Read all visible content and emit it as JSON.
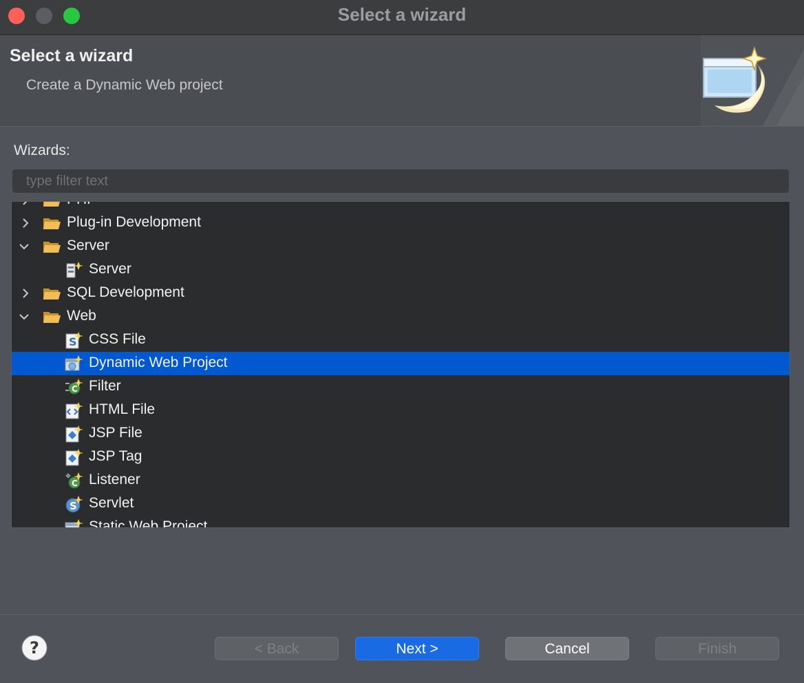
{
  "window": {
    "title": "Select a wizard"
  },
  "header": {
    "title": "Select a wizard",
    "subtitle": "Create a Dynamic Web project"
  },
  "wizards": {
    "label": "Wizards:",
    "filter_placeholder": "type filter text",
    "items": [
      {
        "label": "PHP",
        "indent": 0,
        "type": "folder",
        "state": "collapsed",
        "icon": "folder-icon"
      },
      {
        "label": "Plug-in Development",
        "indent": 0,
        "type": "folder",
        "state": "collapsed",
        "icon": "folder-icon"
      },
      {
        "label": "Server",
        "indent": 0,
        "type": "folder",
        "state": "expanded",
        "icon": "folder-icon"
      },
      {
        "label": "Server",
        "indent": 1,
        "type": "item",
        "icon": "server-wizard-icon"
      },
      {
        "label": "SQL Development",
        "indent": 0,
        "type": "folder",
        "state": "collapsed",
        "icon": "folder-icon"
      },
      {
        "label": "Web",
        "indent": 0,
        "type": "folder",
        "state": "expanded",
        "icon": "folder-icon"
      },
      {
        "label": "CSS File",
        "indent": 1,
        "type": "item",
        "icon": "css-file-icon"
      },
      {
        "label": "Dynamic Web Project",
        "indent": 1,
        "type": "item",
        "icon": "dynamic-web-project-icon",
        "selected": true
      },
      {
        "label": "Filter",
        "indent": 1,
        "type": "item",
        "icon": "filter-class-icon"
      },
      {
        "label": "HTML File",
        "indent": 1,
        "type": "item",
        "icon": "html-file-icon"
      },
      {
        "label": "JSP File",
        "indent": 1,
        "type": "item",
        "icon": "jsp-file-icon"
      },
      {
        "label": "JSP Tag",
        "indent": 1,
        "type": "item",
        "icon": "jsp-tag-icon"
      },
      {
        "label": "Listener",
        "indent": 1,
        "type": "item",
        "icon": "listener-class-icon"
      },
      {
        "label": "Servlet",
        "indent": 1,
        "type": "item",
        "icon": "servlet-icon"
      },
      {
        "label": "Static Web Project",
        "indent": 1,
        "type": "item",
        "icon": "static-web-project-icon"
      }
    ]
  },
  "buttons": {
    "back": "< Back",
    "next": "Next >",
    "cancel": "Cancel",
    "finish": "Finish"
  },
  "colors": {
    "selection": "#0059d1",
    "primary_button": "#1a6ae3",
    "folder": "#f0b64a"
  }
}
